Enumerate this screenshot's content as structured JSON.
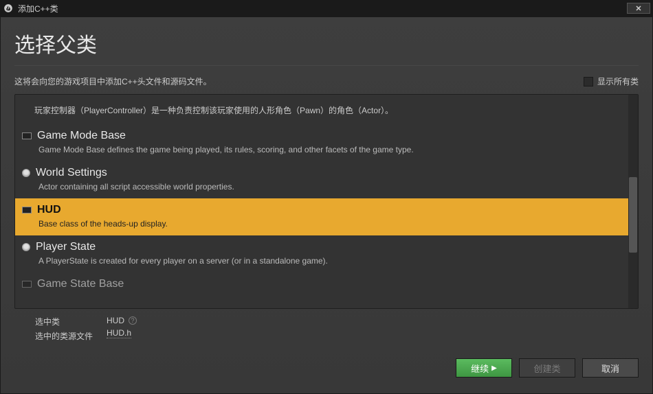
{
  "titlebar": {
    "title": "添加C++类"
  },
  "header": {
    "heading": "选择父类",
    "subhead": "这将会向您的游戏项目中添加C++头文件和源码文件。",
    "showall_label": "显示所有类"
  },
  "list": {
    "intro": "玩家控制器（PlayerController）是一种负责控制该玩家使用的人形角色（Pawn）的角色（Actor）。",
    "items": [
      {
        "name": "Game Mode Base",
        "desc": "Game Mode Base defines the game being played, its rules, scoring, and other facets of the game type.",
        "icon": "box",
        "selected": false
      },
      {
        "name": "World Settings",
        "desc": "Actor containing all script accessible world properties.",
        "icon": "radio",
        "selected": false
      },
      {
        "name": "HUD",
        "desc": "Base class of the heads-up display.",
        "icon": "box",
        "selected": true
      },
      {
        "name": "Player State",
        "desc": "A PlayerState is created for every player on a server (or in a standalone game).",
        "icon": "radio",
        "selected": false
      },
      {
        "name": "Game State Base",
        "desc": "",
        "icon": "box",
        "selected": false
      }
    ]
  },
  "selection": {
    "selected_class_label": "选中类",
    "selected_class_value": "HUD",
    "source_file_label": "选中的类源文件",
    "source_file_value": "HUD.h"
  },
  "footer": {
    "continue": "继续",
    "create": "创建类",
    "cancel": "取消"
  }
}
